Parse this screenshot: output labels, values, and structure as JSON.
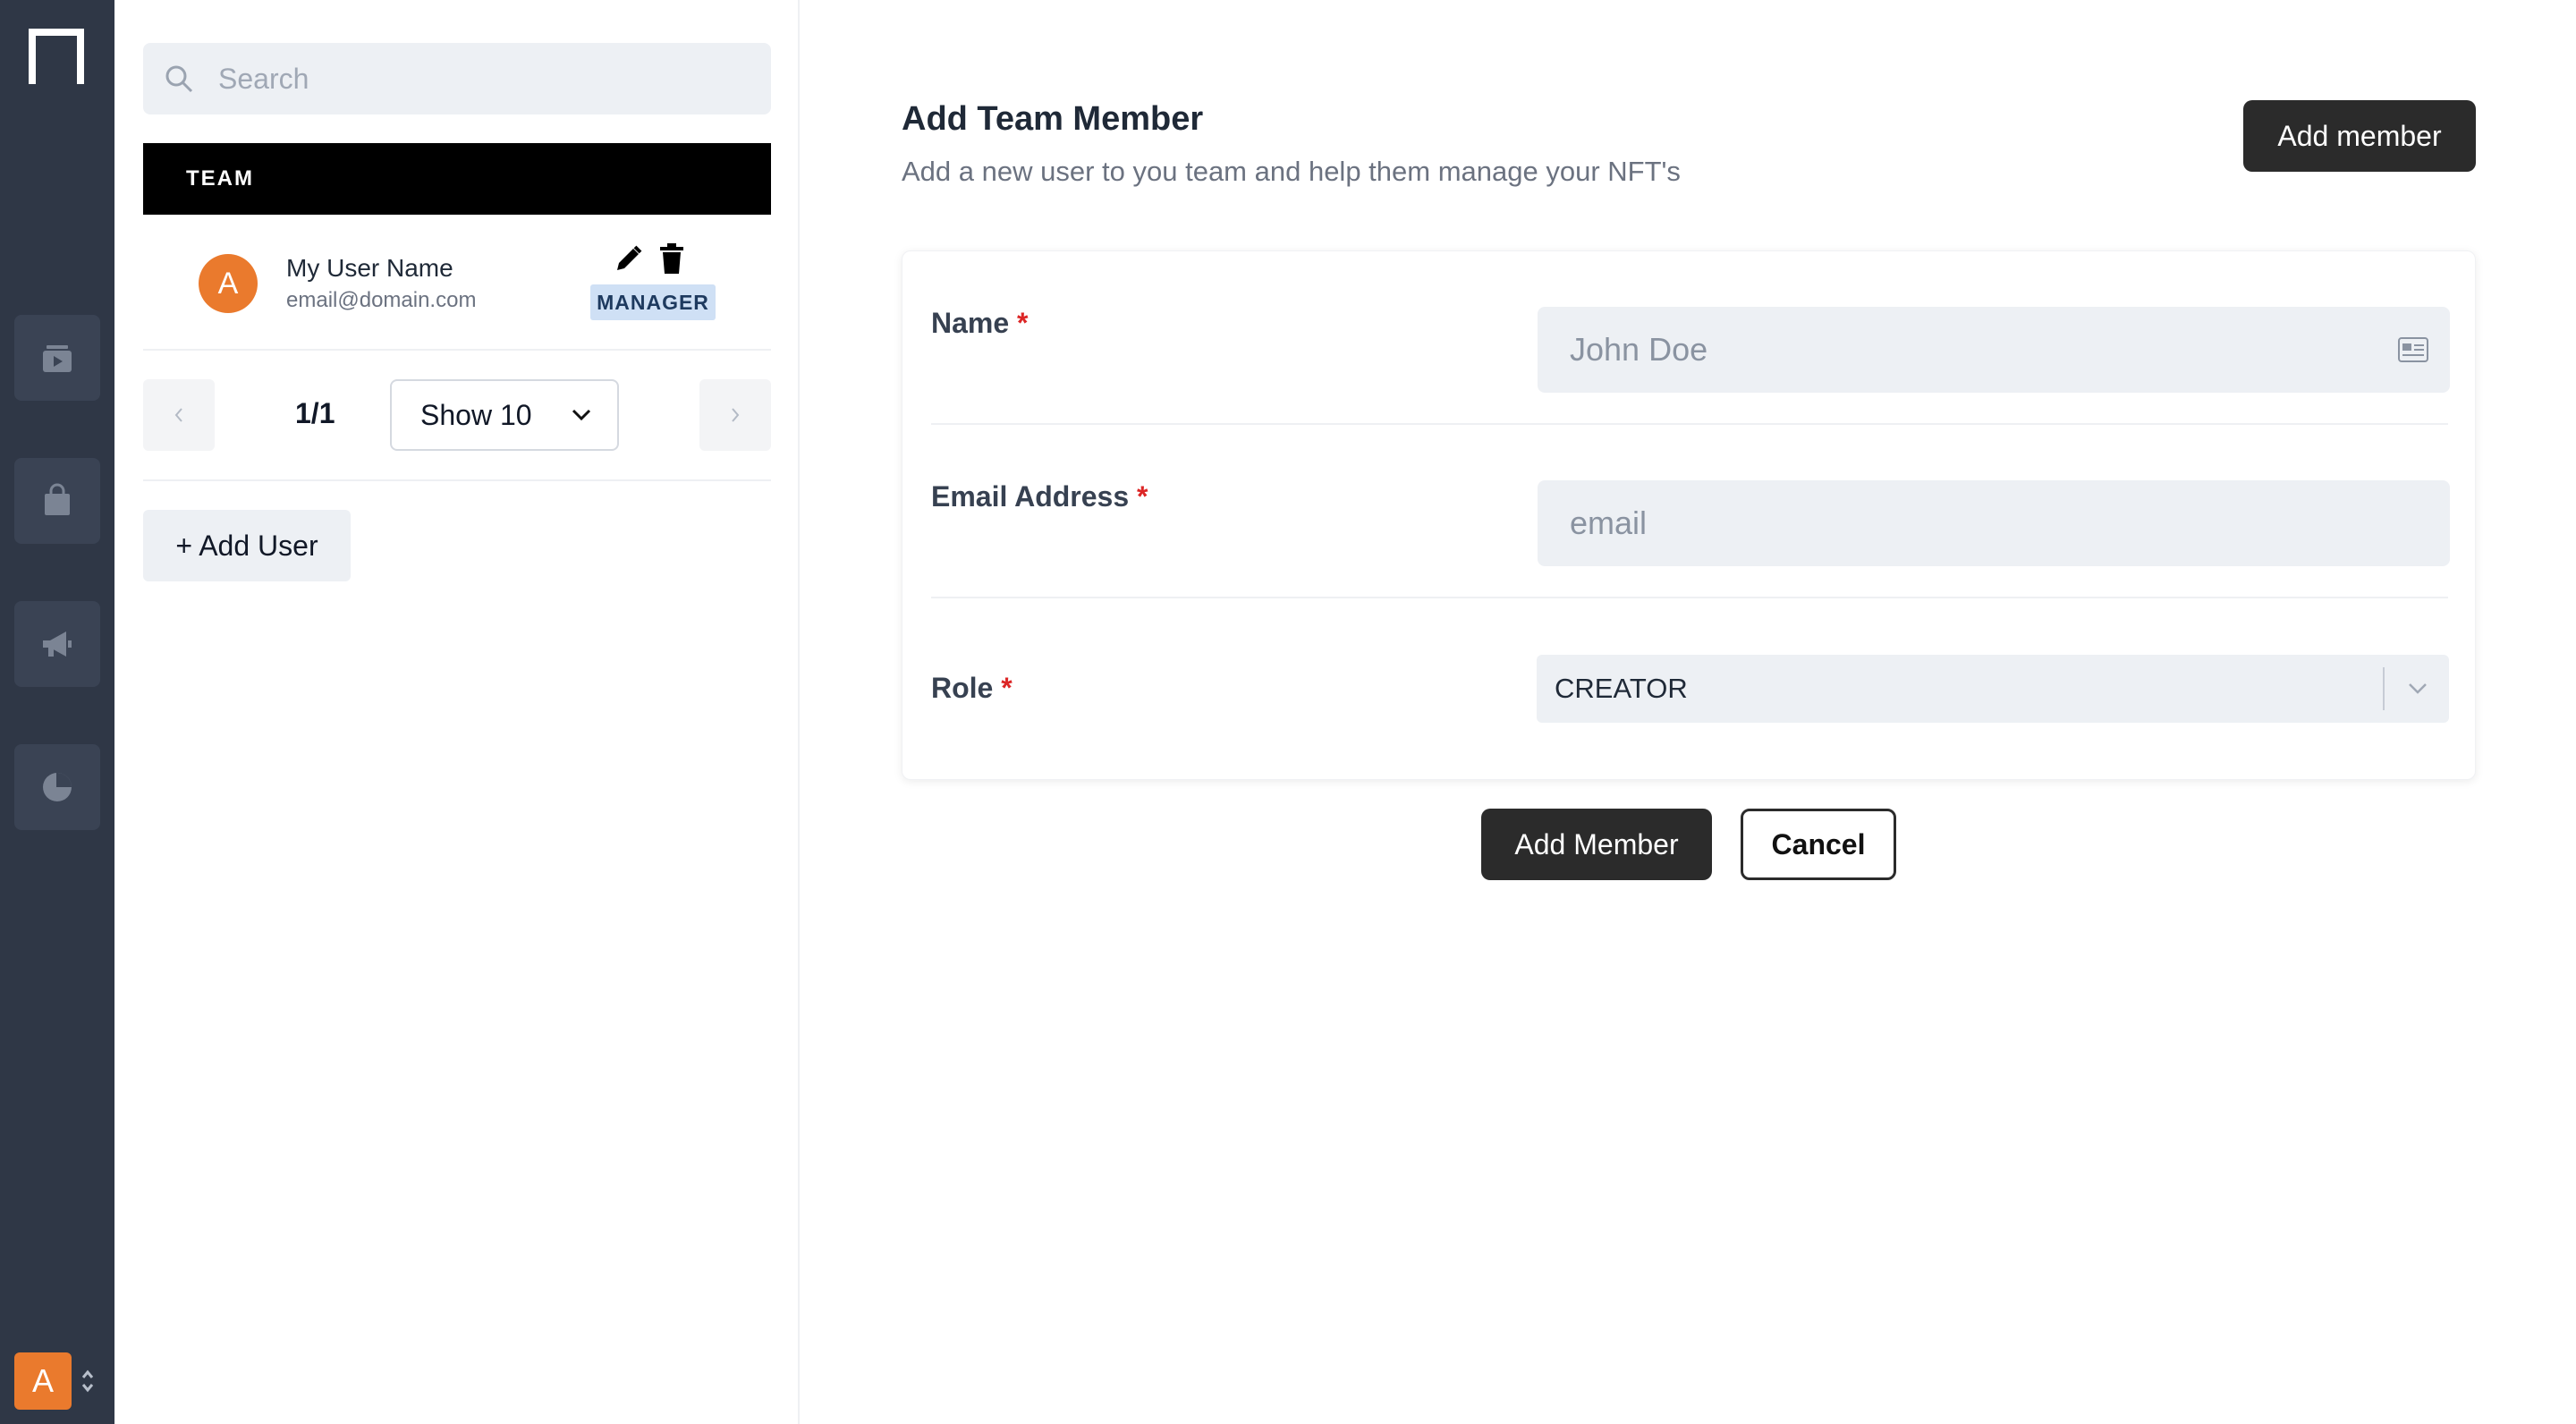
{
  "sidebar": {
    "logo": "n-logo-icon",
    "nav_icons": [
      "video-icon",
      "bag-icon",
      "megaphone-icon",
      "pie-chart-icon"
    ],
    "user_avatar_letter": "A"
  },
  "list_panel": {
    "search": {
      "placeholder": "Search",
      "value": ""
    },
    "section_title": "TEAM",
    "members": [
      {
        "avatar_letter": "A",
        "name": "My User Name",
        "email": "email@domain.com",
        "role": "MANAGER"
      }
    ],
    "pagination": {
      "page": "1/1",
      "page_size": "Show 10"
    },
    "add_user_label": "+ Add User"
  },
  "main": {
    "title": "Add Team Member",
    "subtitle": "Add a new user to you team and help them manage your NFT's",
    "header_button": "Add member",
    "form": {
      "name": {
        "label": "Name",
        "placeholder": "John Doe",
        "value": ""
      },
      "email": {
        "label": "Email Address",
        "placeholder": "email",
        "value": ""
      },
      "role": {
        "label": "Role",
        "value": "CREATOR"
      },
      "required_mark": "*"
    },
    "submit_label": "Add Member",
    "cancel_label": "Cancel"
  },
  "colors": {
    "rail": "#2f3746",
    "accent_orange": "#ea7a2d",
    "dark_button": "#2b2b2b",
    "required": "#dc2626",
    "badge": "#cfe0f5"
  }
}
